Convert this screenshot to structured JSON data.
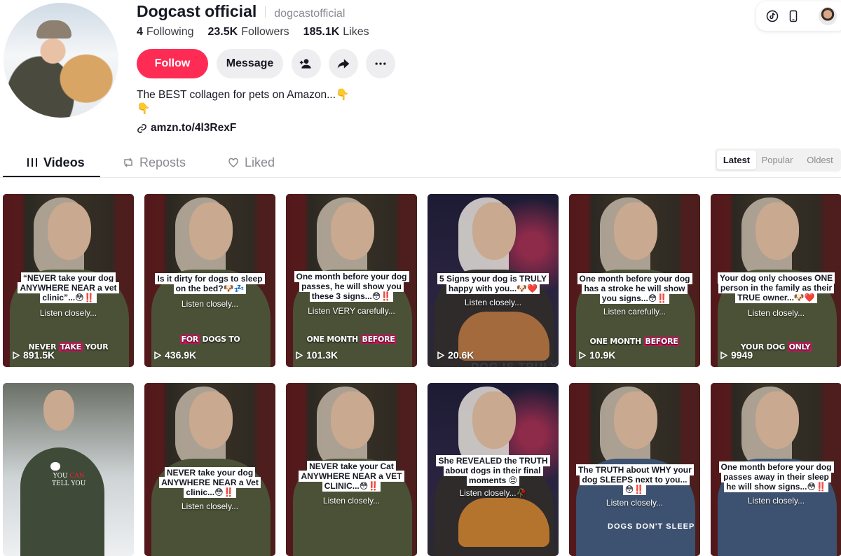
{
  "profile": {
    "name": "Dogcast official",
    "handle": "dogcastofficial",
    "stats": [
      {
        "value": "4",
        "label": "Following"
      },
      {
        "value": "23.5K",
        "label": "Followers"
      },
      {
        "value": "185.1K",
        "label": "Likes"
      }
    ],
    "follow_label": "Follow",
    "message_label": "Message",
    "bio_line1": "The BEST collagen for pets on Amazon...👇",
    "bio_line2": "👇",
    "link": "amzn.to/4l3RexF"
  },
  "tabs": [
    {
      "label": "Videos",
      "active": true
    },
    {
      "label": "Reposts",
      "active": false
    },
    {
      "label": "Liked",
      "active": false
    }
  ],
  "sort": [
    "Latest",
    "Popular",
    "Oldest"
  ],
  "colors": {
    "accent": "#fe2c55",
    "text": "#161823",
    "muted": "#8a8b91"
  },
  "videos": [
    {
      "caption": "“NEVER take your dog ANYWHERE NEAR a vet clinic”...😳‼️",
      "sub": "Listen closely...",
      "burn_a": "NEVER ",
      "burn_hl": "TAKE",
      "burn_b": " YOUR",
      "views": "891.5K"
    },
    {
      "caption": "Is it dirty for dogs to sleep on the bed?🐶💤",
      "sub": "Listen closely...",
      "burn_a": "",
      "burn_hl": "FOR",
      "burn_b": " DOGS TO",
      "views": "436.9K"
    },
    {
      "caption": "One month before your dog passes, he will show you these 3 signs...😳‼️",
      "sub": "Listen VERY carefully...",
      "burn_a": "ONE MONTH ",
      "burn_hl": "BEFORE",
      "burn_b": "",
      "views": "101.3K"
    },
    {
      "caption": "5 Signs your dog is TRULY happy with you...🐶❤️",
      "sub": "Listen closely...",
      "burn_a": "",
      "burn_hl": "",
      "burn_b": "",
      "views": "20.6K",
      "big": "DOG IS TRULY"
    },
    {
      "caption": "One month before your dog has a stroke he will show you signs...😳‼️",
      "sub": "Listen carefully...",
      "burn_a": "ONE MONTH ",
      "burn_hl": "BEFORE",
      "burn_b": "",
      "views": "10.9K"
    },
    {
      "caption": "Your dog only chooses ONE person in the family as their TRUE owner...🐶❤️",
      "sub": "Listen closely...",
      "burn_a": "YOUR DOG ",
      "burn_hl": "ONLY",
      "burn_b": "",
      "views": "9949"
    },
    {
      "caption": "",
      "sub": "",
      "burn_a": "",
      "burn_hl": "",
      "burn_b": "",
      "views": "",
      "youcan_a": "YOU ",
      "youcan_hl": "CAN",
      "youcan_b": "TELL YOU"
    },
    {
      "caption": "NEVER take your dog ANYWHERE NEAR a Vet clinic...😳‼️",
      "sub": "Listen closely...",
      "burn_a": "",
      "burn_hl": "",
      "burn_b": "",
      "views": ""
    },
    {
      "caption": "NEVER take your Cat ANYWHERE NEAR a VET CLINIC...😳‼️",
      "sub": "Listen closely...",
      "burn_a": "",
      "burn_hl": "",
      "burn_b": "",
      "views": ""
    },
    {
      "caption": "She REVEALED the TRUTH about dogs in their final moments 😔",
      "sub": "Listen closely...🥀",
      "burn_a": "",
      "burn_hl": "",
      "burn_b": "",
      "views": ""
    },
    {
      "caption": "The TRUTH about WHY your dog SLEEPS next to you...😳‼️",
      "sub": "Listen closely...",
      "burn_a": "",
      "burn_hl": "",
      "burn_b": "",
      "views": "",
      "big": "DOGS DON'T SLEEP"
    },
    {
      "caption": "One month before your dog passes away in their sleep he will show signs...😳‼️",
      "sub": "Listen closely...",
      "burn_a": "",
      "burn_hl": "",
      "burn_b": "",
      "views": ""
    }
  ]
}
